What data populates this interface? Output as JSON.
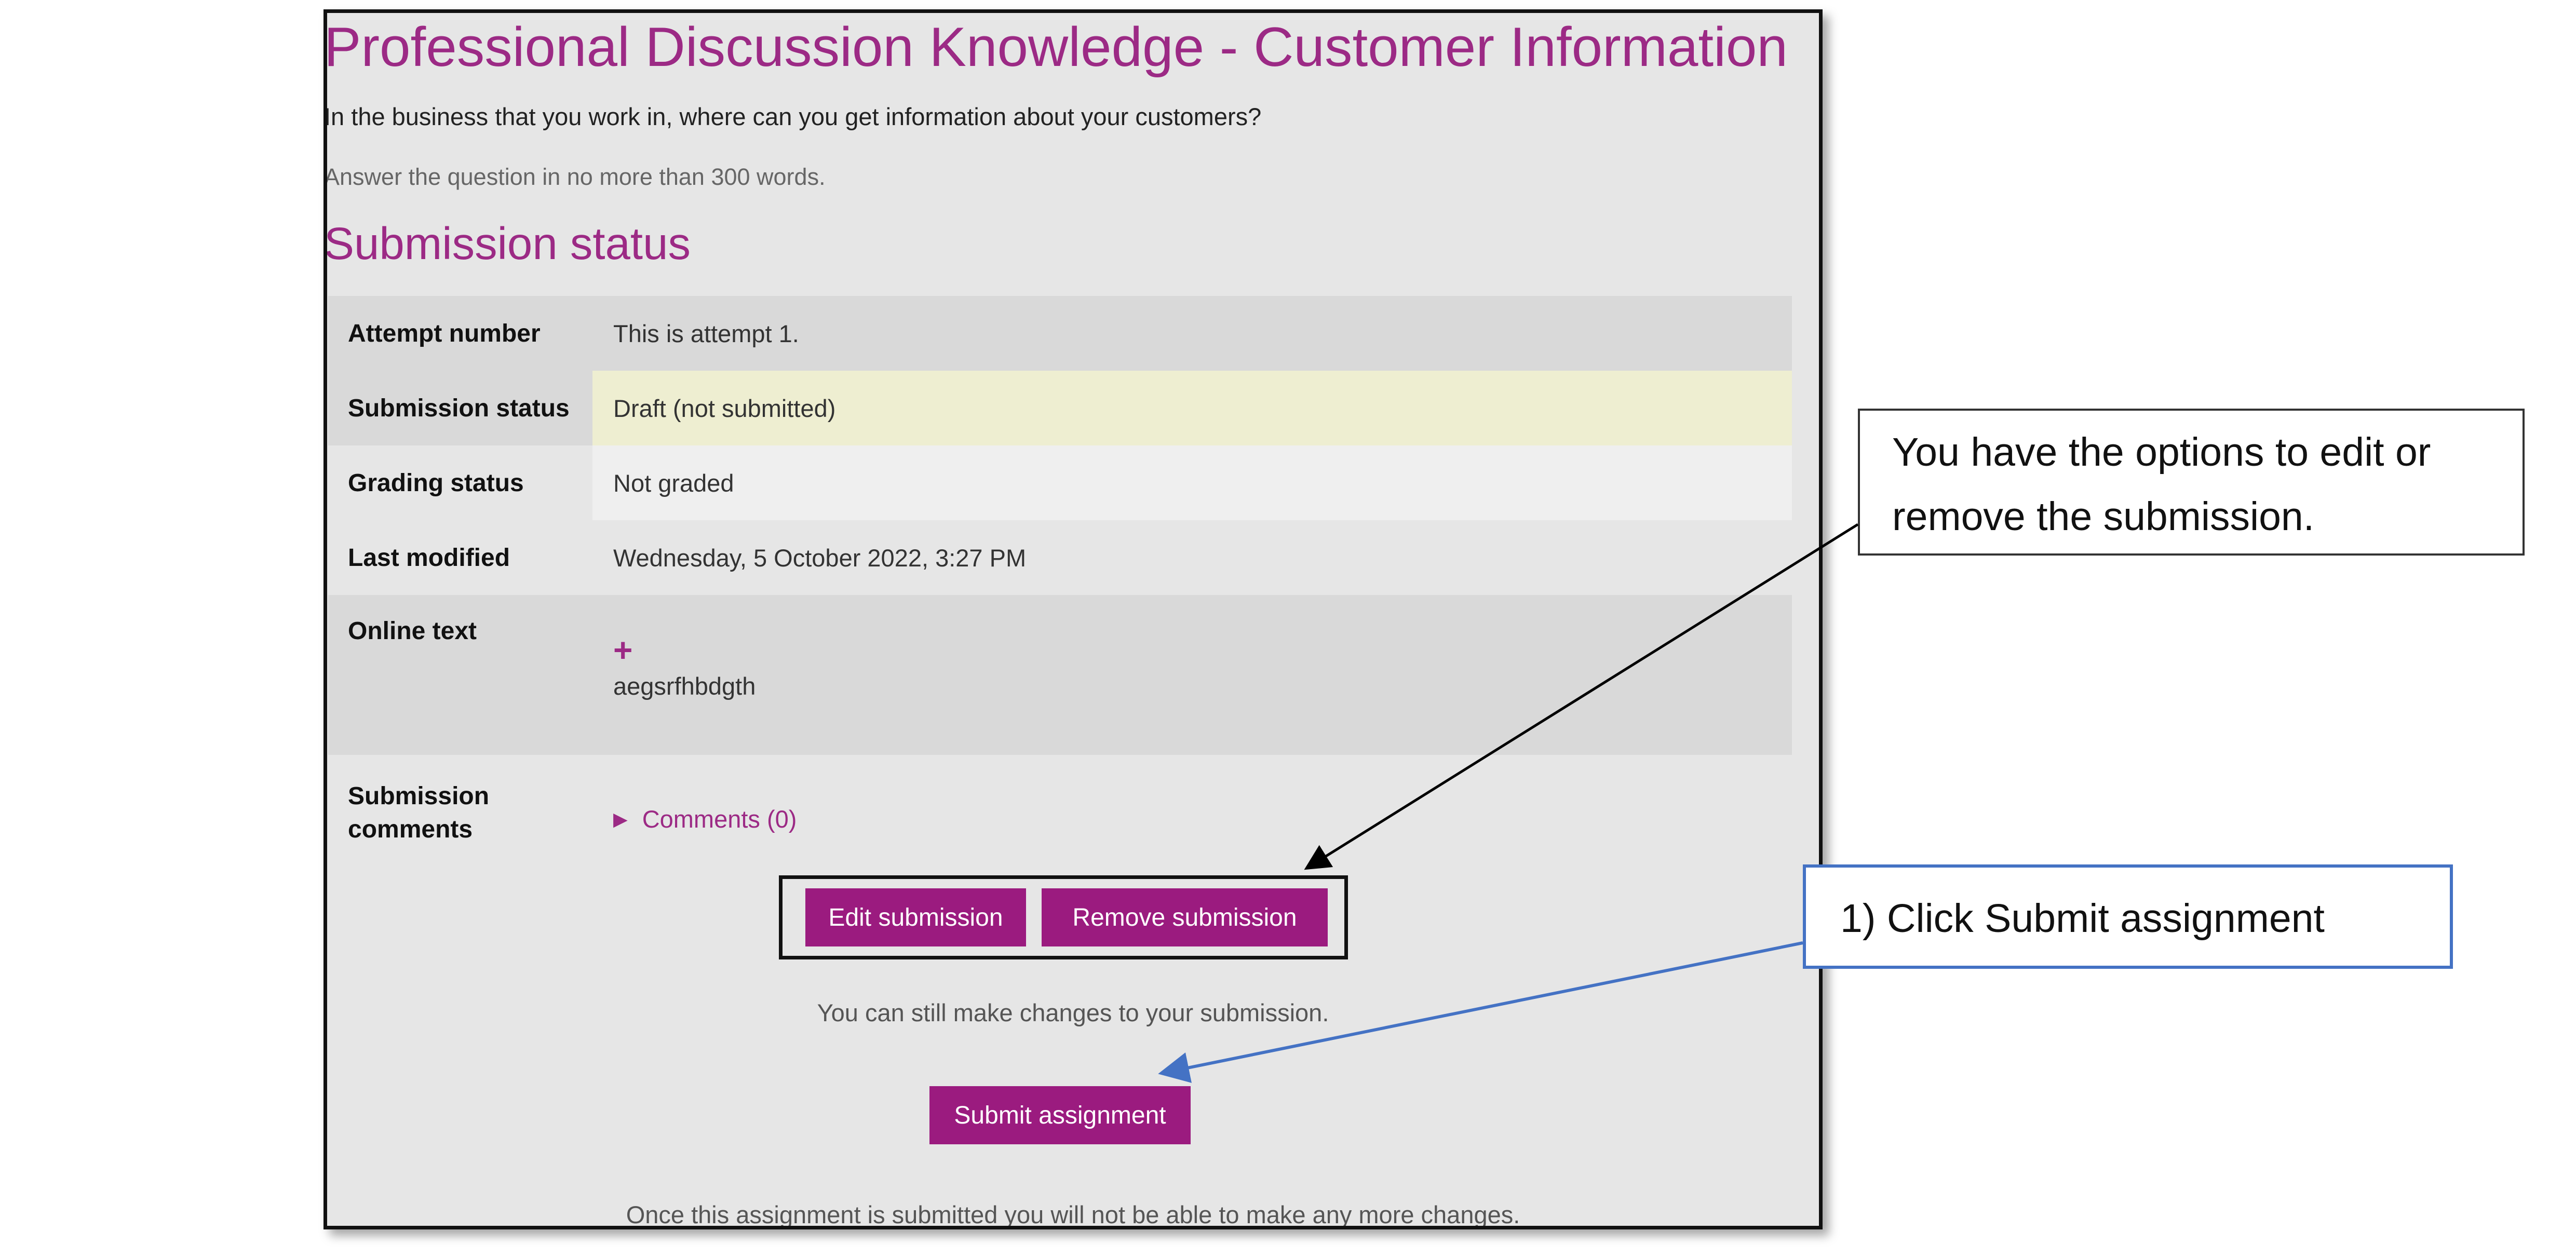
{
  "page": {
    "title": "Professional Discussion Knowledge - Customer Information",
    "question": "In the business that you work in, where can you get information about your customers?",
    "instruction": "Answer the question in no more than 300 words.",
    "section_title": "Submission status"
  },
  "status_table": {
    "rows": [
      {
        "label": "Attempt number",
        "value": "This is attempt 1."
      },
      {
        "label": "Submission status",
        "value": "Draft (not submitted)"
      },
      {
        "label": "Grading status",
        "value": "Not graded"
      },
      {
        "label": "Last modified",
        "value": "Wednesday, 5 October 2022, 3:27 PM"
      },
      {
        "label": "Online text",
        "value": "aegsrfhbdgth",
        "icon": "plus-icon"
      },
      {
        "label": "Submission comments",
        "value": "Comments (0)",
        "icon": "caret-right-icon"
      }
    ]
  },
  "actions": {
    "edit_label": "Edit submission",
    "remove_label": "Remove submission",
    "changes_hint": "You can still make changes to your submission.",
    "submit_label": "Submit assignment",
    "final_hint": "Once this assignment is submitted you will not be able to make any more changes."
  },
  "callouts": {
    "edit_note": "You have the options to edit or remove the submission.",
    "submit_note": "1) Click Submit assignment"
  },
  "colors": {
    "brand": "#9c2a85",
    "button": "#9b1b7f",
    "draft_row": "#eeeed1",
    "callout_border_blue": "#4472c4"
  }
}
